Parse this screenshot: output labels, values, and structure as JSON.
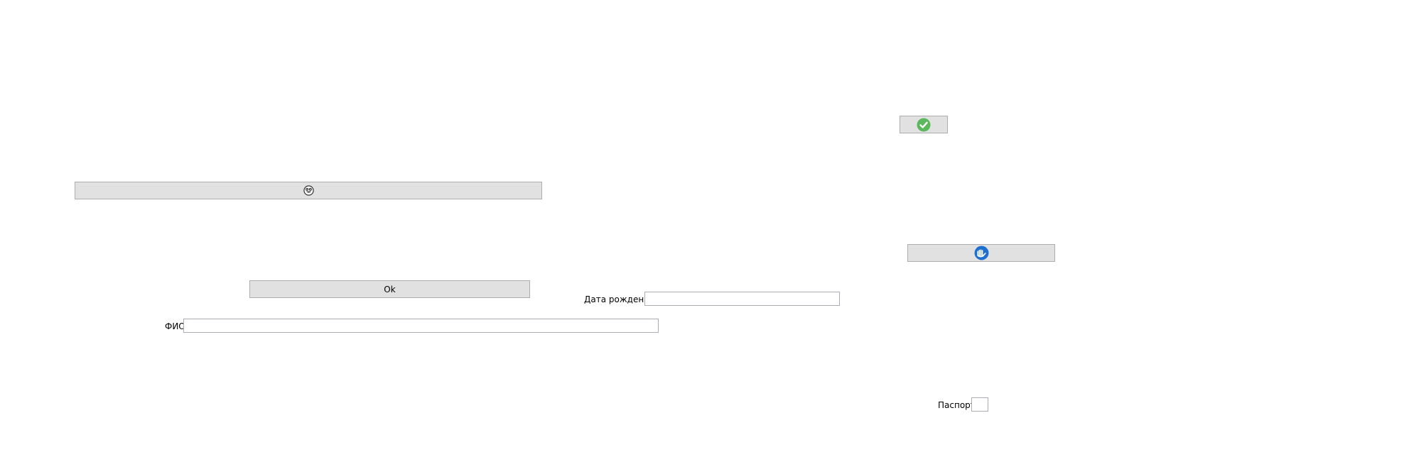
{
  "buttons": {
    "smiley_button": {
      "icon": "smiley-face-icon"
    },
    "check_button": {
      "icon": "green-check-icon",
      "icon_color": "#5cb85c"
    },
    "hand_button": {
      "icon": "blue-hand-icon",
      "icon_color": "#1e6fd0"
    },
    "ok_button": {
      "label": "Ok"
    }
  },
  "fields": {
    "birth_date": {
      "label": "Дата рождения",
      "value": ""
    },
    "full_name": {
      "label": "ФИО",
      "value": ""
    },
    "passport": {
      "label": "Паспорт",
      "value": ""
    }
  },
  "colors": {
    "button_bg": "#e1e1e1",
    "button_border": "#adadad",
    "field_border": "#abadb3"
  }
}
